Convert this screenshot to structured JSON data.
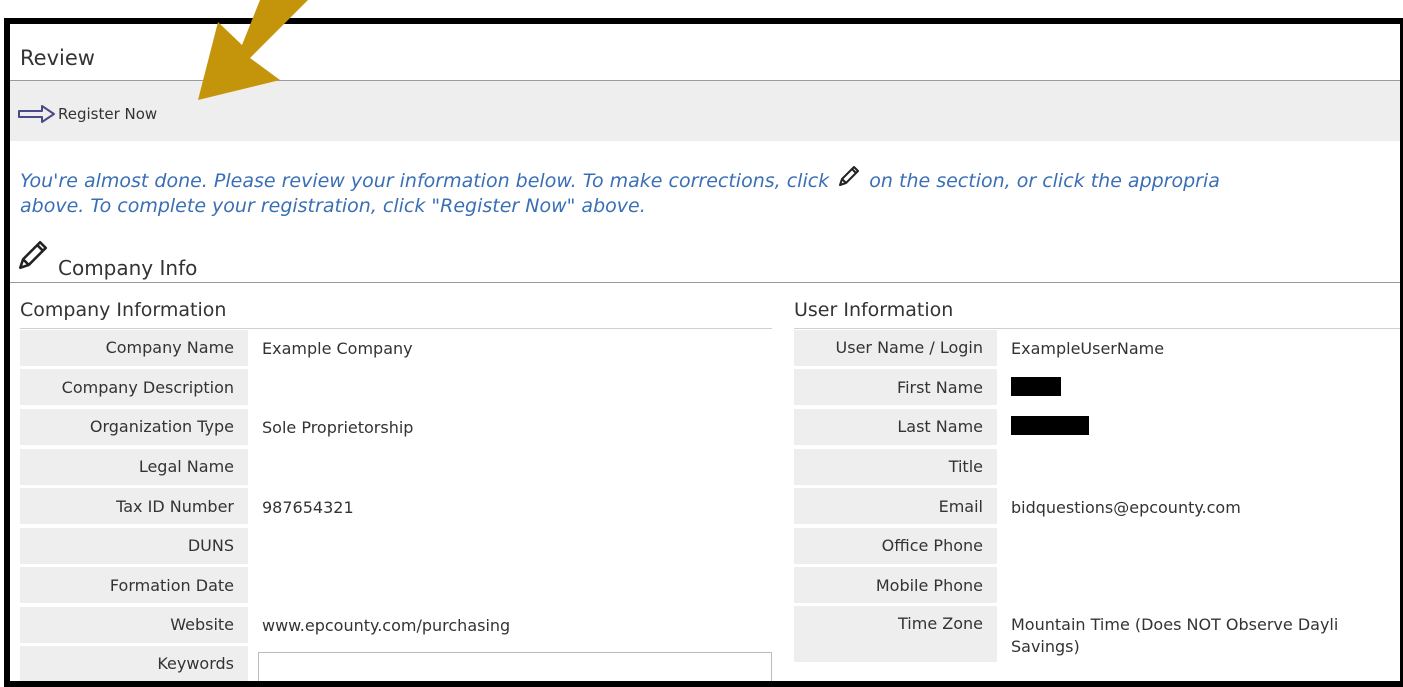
{
  "header": {
    "title": "Review"
  },
  "toolbar": {
    "register_label": "Register Now"
  },
  "message": {
    "line1_part1": "You're almost done. Please review your information below. To make corrections, click",
    "line1_part2": "on the section, or click the appropria",
    "line2": "above. To complete your registration, click \"Register Now\" above."
  },
  "section": {
    "title": "Company Info"
  },
  "company": {
    "title": "Company Information",
    "rows": [
      {
        "label": "Company Name",
        "value": "Example Company"
      },
      {
        "label": "Company Description",
        "value": ""
      },
      {
        "label": "Organization Type",
        "value": "Sole Proprietorship"
      },
      {
        "label": "Legal Name",
        "value": ""
      },
      {
        "label": "Tax ID Number",
        "value": "987654321"
      },
      {
        "label": "DUNS",
        "value": ""
      },
      {
        "label": "Formation Date",
        "value": ""
      },
      {
        "label": "Website",
        "value": "www.epcounty.com/purchasing"
      },
      {
        "label": "Keywords",
        "value": ""
      }
    ]
  },
  "user": {
    "title": "User Information",
    "rows": [
      {
        "label": "User Name / Login",
        "value": "ExampleUserName"
      },
      {
        "label": "First Name",
        "value": ""
      },
      {
        "label": "Last Name",
        "value": ""
      },
      {
        "label": "Title",
        "value": ""
      },
      {
        "label": "Email",
        "value": "bidquestions@epcounty.com"
      },
      {
        "label": "Office Phone",
        "value": ""
      },
      {
        "label": "Mobile Phone",
        "value": ""
      },
      {
        "label": "Time Zone",
        "value": "Mountain Time (Does NOT Observe Dayli Savings)"
      }
    ]
  },
  "colors": {
    "message": "#3a6fb5",
    "arrow": "#c4950a",
    "label_bg": "#eeeeee"
  },
  "icons": {
    "register": "arrow-right-outline-icon",
    "edit": "pencil-icon",
    "annotation": "annotation-arrow-icon"
  }
}
